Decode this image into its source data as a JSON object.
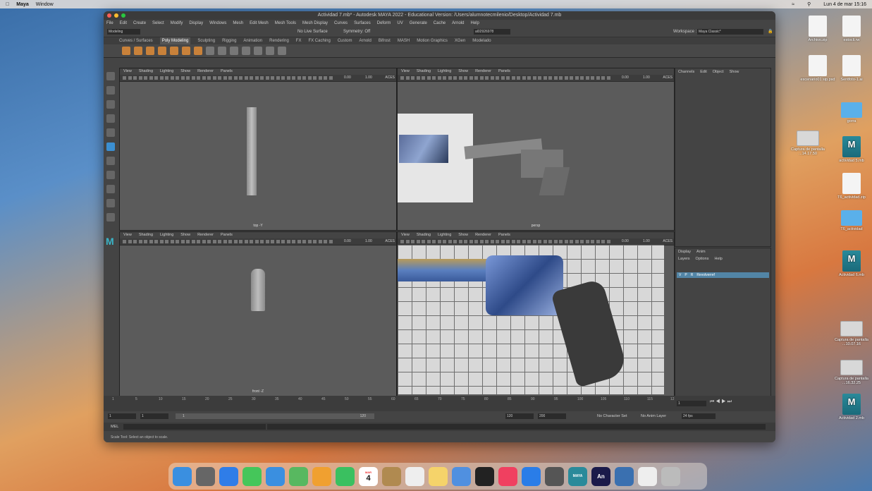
{
  "menubar": {
    "app": "Maya",
    "window": "Window",
    "datetime": "Lun 4 de mar 15:16"
  },
  "window": {
    "title": "Actividad 7.mb* - Autodesk MAYA 2022 - Educational Version: /Users/alumnotecmilenio/Desktop/Actividad 7.mb"
  },
  "main_menu": [
    "File",
    "Edit",
    "Create",
    "Select",
    "Modify",
    "Display",
    "Windows",
    "Mesh",
    "Edit Mesh",
    "Mesh Tools",
    "Mesh Display",
    "Curves",
    "Surfaces",
    "Deform",
    "UV",
    "Generate",
    "Cache",
    "Arnold",
    "Help"
  ],
  "status_line": {
    "mode": "Modeling",
    "live_surface": "No Live Surface",
    "symmetry": "Symmetry: Off",
    "user": "al02926978",
    "workspace_label": "Workspace :",
    "workspace": "Maya Classic*"
  },
  "shelf_tabs": [
    "Curves / Surfaces",
    "Poly Modeling",
    "Sculpting",
    "Rigging",
    "Animation",
    "Rendering",
    "FX",
    "FX Caching",
    "Custom",
    "Arnold",
    "Bifrost",
    "MASH",
    "Motion Graphics",
    "XGen",
    "Modelado"
  ],
  "active_shelf": "Poly Modeling",
  "viewport_menu": [
    "View",
    "Shading",
    "Lighting",
    "Show",
    "Renderer",
    "Panels"
  ],
  "viewport_bar": {
    "exposure": "0.00",
    "gamma": "1.00",
    "colorspace": "ACES"
  },
  "viewports": [
    {
      "label": "top -Y"
    },
    {
      "label": "persp"
    },
    {
      "label": "front -Z"
    },
    {
      "label": "side -X"
    }
  ],
  "channel_box": {
    "tabs": [
      "Channels",
      "Edit",
      "Object",
      "Show"
    ]
  },
  "layer_editor": {
    "tabs": [
      "Display",
      "Anim"
    ],
    "menu": [
      "Layers",
      "Options",
      "Help"
    ],
    "layer": {
      "v": "V",
      "p": "P",
      "r": "R",
      "name": "Revolverref"
    }
  },
  "timeline": {
    "ticks": [
      "1",
      "5",
      "10",
      "15",
      "20",
      "25",
      "30",
      "35",
      "40",
      "45",
      "50",
      "55",
      "60",
      "65",
      "70",
      "75",
      "80",
      "85",
      "90",
      "95",
      "100",
      "105",
      "110",
      "115",
      "12"
    ],
    "current": "1"
  },
  "range": {
    "start": "1",
    "start2": "1",
    "slider_start": "1",
    "slider_end": "120",
    "end": "120",
    "end2": "200",
    "character": "No Character Set",
    "anim_layer": "No Anim Layer",
    "fps": "24 fps"
  },
  "mel": {
    "label": "MEL"
  },
  "help_line": "Scale Tool: Select an object to scale.",
  "desktop_icons": [
    {
      "label": "Archivo.zip",
      "type": "doc"
    },
    {
      "label": "estocli.rw",
      "type": "doc"
    },
    {
      "label": "escenario01 sip.psd",
      "type": "doc"
    },
    {
      "label": "Sentfoto-1.ai",
      "type": "doc"
    },
    {
      "label": "gorra",
      "type": "folder"
    },
    {
      "label": "Captura de pantalla ...14.17.50",
      "type": "shot"
    },
    {
      "label": "actividad 5.mb",
      "type": "mb"
    },
    {
      "label": "T6_actividad.zip",
      "type": "doc"
    },
    {
      "label": "T6_actividad",
      "type": "folder"
    },
    {
      "label": "Actividad 6.mb",
      "type": "mb"
    },
    {
      "label": "Captura de pantalla ...10.07.16",
      "type": "shot"
    },
    {
      "label": "Captura de pantalla ...16.32.25",
      "type": "shot"
    },
    {
      "label": "Actividad 2.mb",
      "type": "mb"
    }
  ],
  "dock": {
    "calendar_month": "MAR",
    "calendar_day": "4",
    "mb_text": "M",
    "maya_text": "MAYA",
    "an_text": "An"
  }
}
